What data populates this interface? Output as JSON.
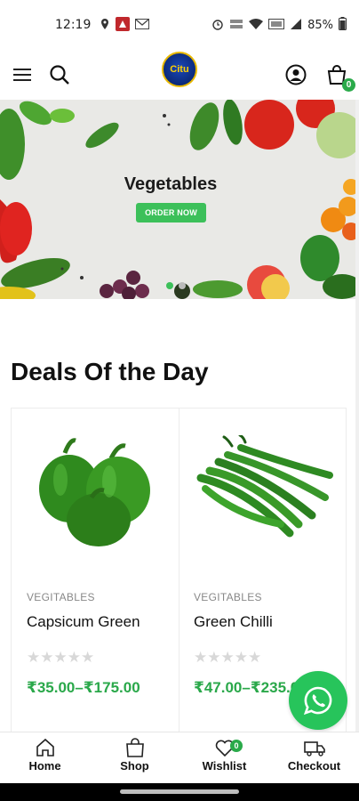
{
  "status_bar": {
    "time": "12:19",
    "battery": "85%",
    "icons": [
      "location-icon",
      "app-notification-icon",
      "gmail-icon",
      "alarm-icon",
      "data-speed-icon",
      "wifi-icon",
      "volte-icon",
      "signal-icon",
      "battery-icon"
    ]
  },
  "header": {
    "logo_text": "Citu",
    "cart_count": "0",
    "icons": [
      "menu-icon",
      "search-icon",
      "account-icon",
      "cart-icon"
    ]
  },
  "banner": {
    "title": "Vegetables",
    "button_label": "ORDER NOW",
    "active_slide": 1,
    "slide_count": 2
  },
  "deals": {
    "title": "Deals Of the Day",
    "products": [
      {
        "category": "VEGITABLES",
        "name": "Capsicum Green",
        "stars": "★★★★★",
        "price": "₹35.00–₹175.00",
        "image": "green-capsicum"
      },
      {
        "category": "VEGITABLES",
        "name": "Green Chilli",
        "stars": "★★★★★",
        "price": "₹47.00–₹235.00",
        "image": "green-chilli"
      }
    ]
  },
  "bottom_nav": {
    "items": [
      {
        "label": "Home",
        "icon": "home-icon"
      },
      {
        "label": "Shop",
        "icon": "shopping-bag-icon"
      },
      {
        "label": "Wishlist",
        "icon": "heart-icon",
        "badge": "0"
      },
      {
        "label": "Checkout",
        "icon": "truck-icon"
      }
    ]
  },
  "colors": {
    "accent_green": "#3cc05a",
    "price_green": "#2aa84a",
    "whatsapp_green": "#27c45b"
  }
}
